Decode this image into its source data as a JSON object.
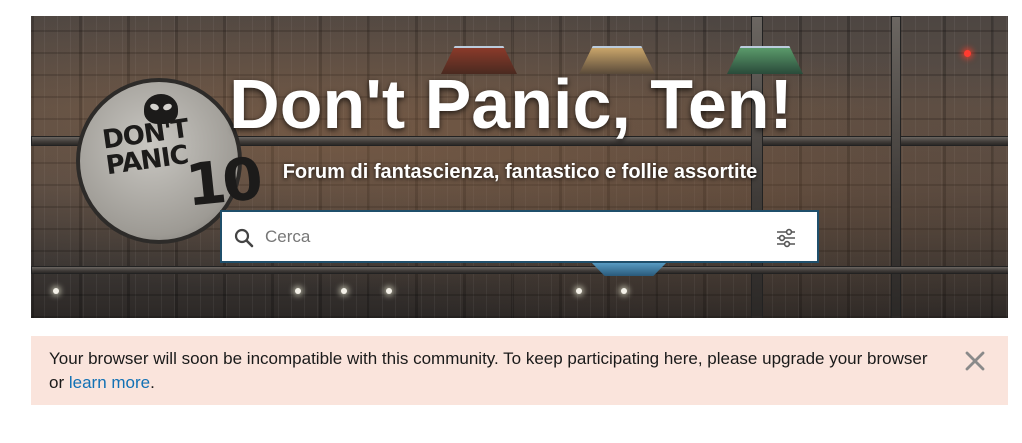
{
  "banner": {
    "title": "Don't Panic, Ten!",
    "subtitle": "Forum di fantascienza, fantastico e follie assortite",
    "logo": {
      "text": "DON'T PANIC",
      "number": "10"
    }
  },
  "search": {
    "placeholder": "Cerca",
    "value": ""
  },
  "notice": {
    "message": "Your browser will soon be incompatible with this community. To keep participating here, please upgrade your browser or ",
    "link_label": "learn more",
    "suffix": ".",
    "background": "#fae4dc",
    "link_color": "#1271b5"
  },
  "colors": {
    "search_border": "#1f4f6b",
    "title": "#ffffff"
  },
  "icons": {
    "search": "search-icon",
    "filter": "filter-sliders-icon",
    "close": "close-icon"
  }
}
